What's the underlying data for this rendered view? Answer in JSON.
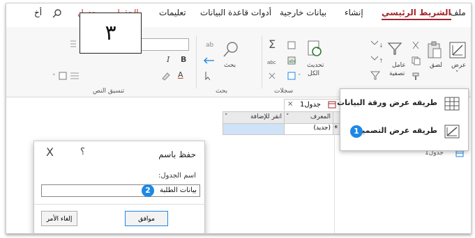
{
  "menu": {
    "items": [
      "ملف",
      "الشريط الرئيسي",
      "إنشاء",
      "بيانات خارجية",
      "أدوات قاعدة البيانات",
      "تعليمات",
      "الحقول",
      "جدول",
      "أخ"
    ],
    "active": "الشريط الرئيسي"
  },
  "ribbon": {
    "view_label": "عرض",
    "paste_label": "لصق",
    "filter_label": "عامل",
    "filter_label2": "تصفية",
    "refresh_label": "تحديث",
    "refresh_label2": "الكل",
    "find_label": "بحث",
    "records_group": "سجلات",
    "find_group": "بحث",
    "text_group": "تنسيق النص",
    "bold": "B",
    "italic": "I",
    "underline_color": "A"
  },
  "view_menu": {
    "datasheet": "طريقه عرض ورقة البيانات",
    "design": "طريقه عرض التصميم"
  },
  "nav": {
    "object": "جدول1"
  },
  "table": {
    "tab": "جدول1",
    "col_id": "المعرف",
    "col_add": "انقر للإضافة",
    "new_row": "(جديد)"
  },
  "dialog": {
    "title": "حفظ باسم",
    "help": "؟",
    "close": "X",
    "label": "اسم الجدول:",
    "value": "بيانات الطلبة",
    "ok": "موافق",
    "cancel": "إلغاء الأمر"
  },
  "callouts": {
    "step1": "1",
    "step2": "2",
    "step3": "٣"
  },
  "colors": {
    "accent": "#a4262c",
    "badge": "#1e88e5"
  }
}
